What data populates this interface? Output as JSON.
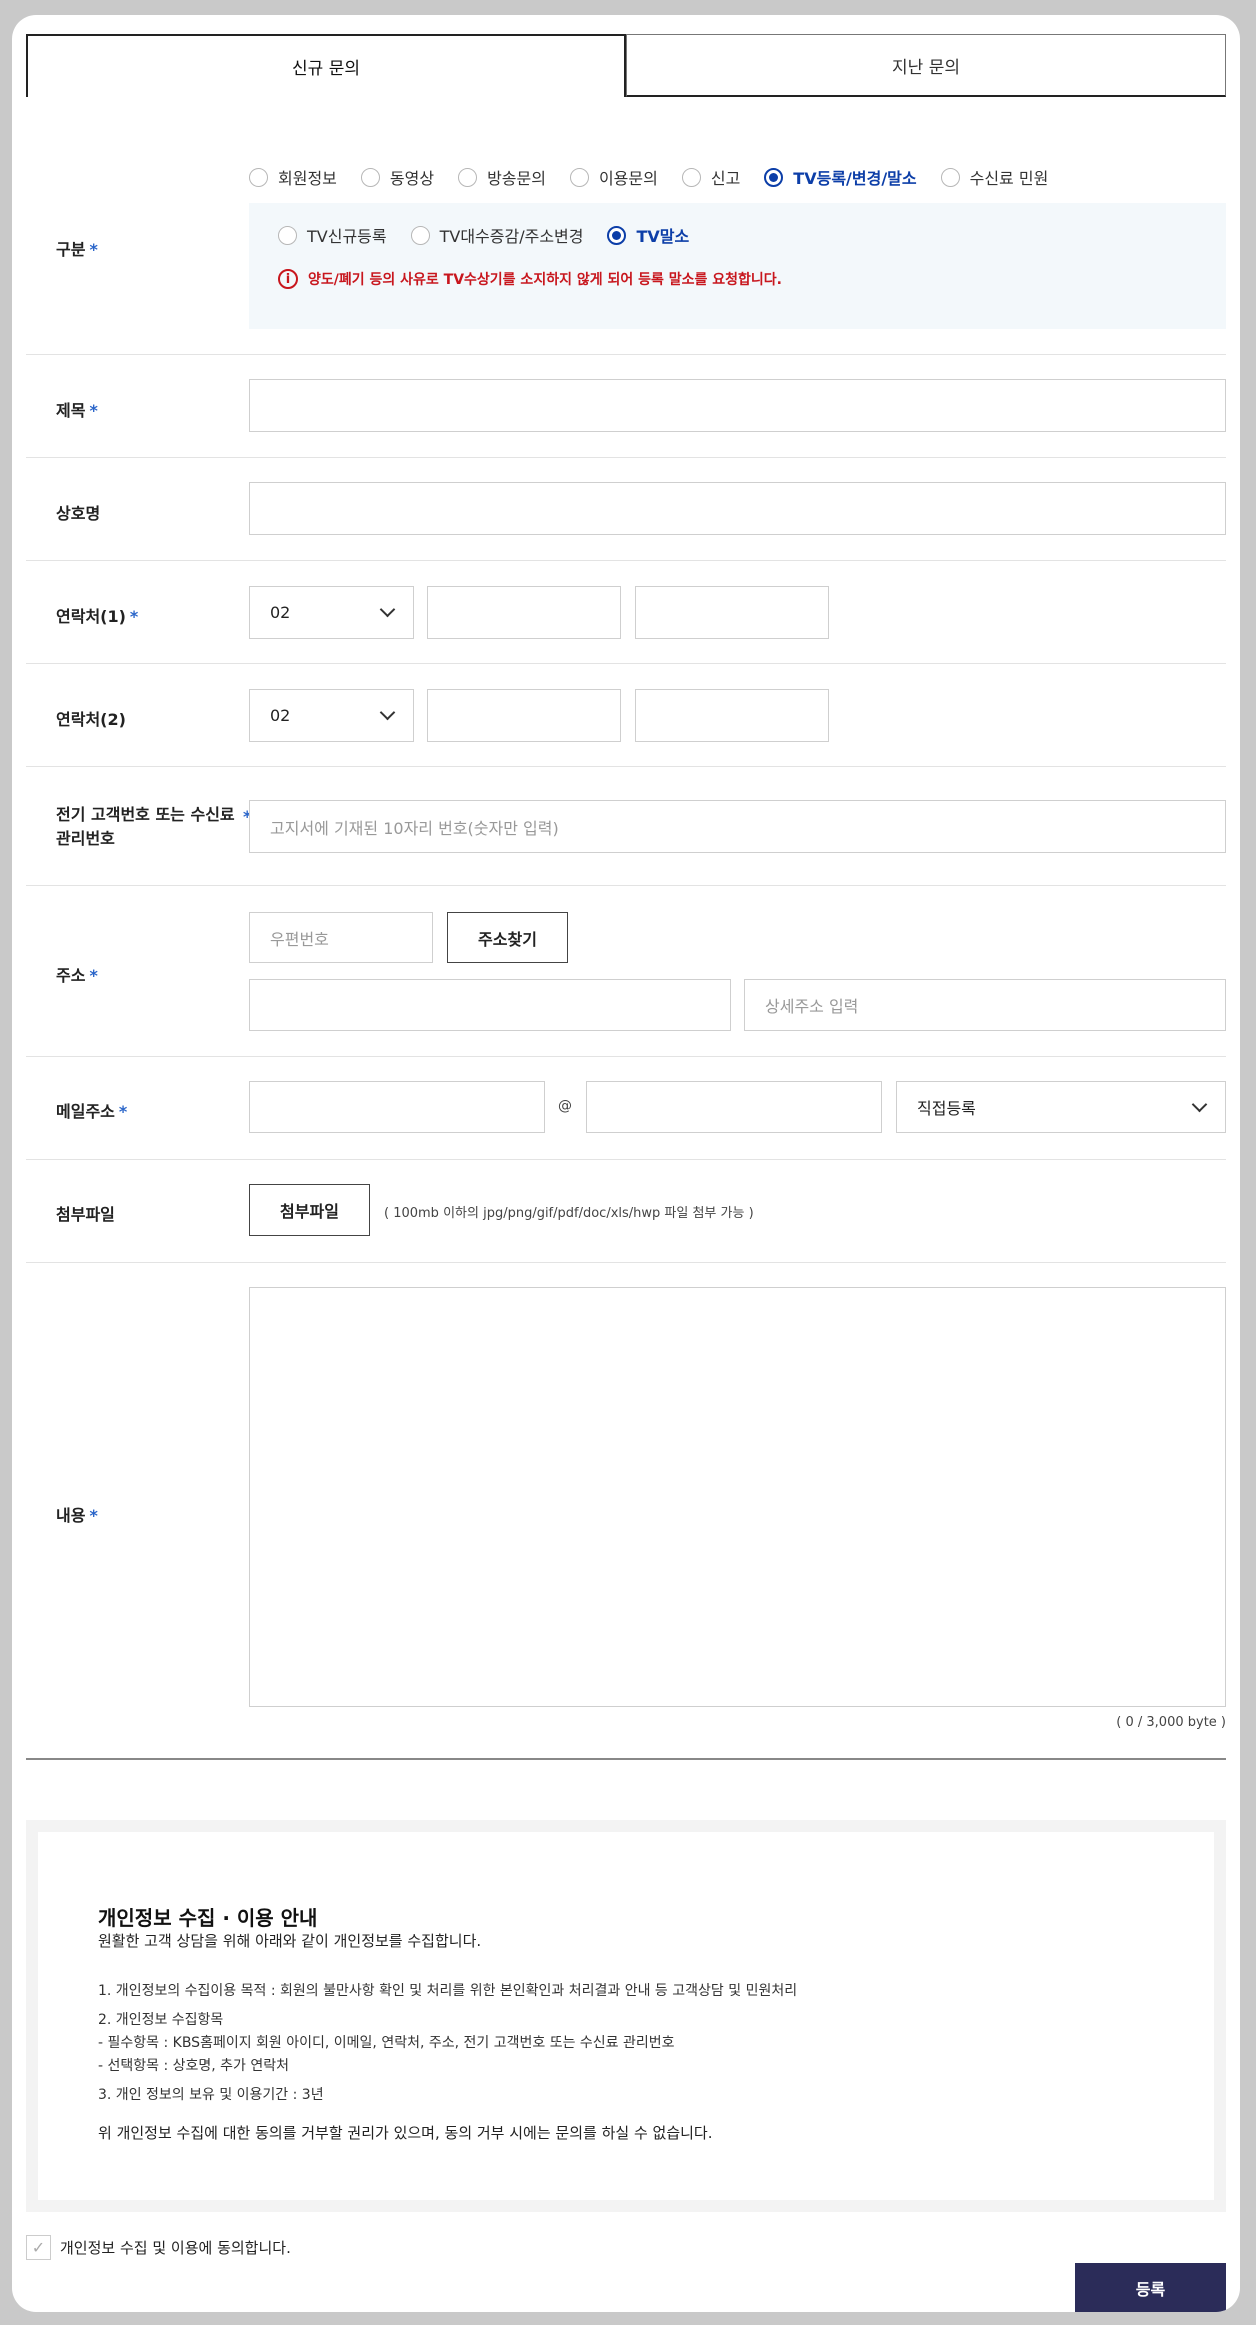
{
  "tabs": {
    "new": "신규 문의",
    "past": "지난 문의"
  },
  "form": {
    "category": {
      "label": "구분",
      "options": [
        "회원정보",
        "동영상",
        "방송문의",
        "이용문의",
        "신고",
        "TV등록/변경/말소",
        "수신료 민원"
      ],
      "selected": "TV등록/변경/말소",
      "sub_options": [
        "TV신규등록",
        "TV대수증감/주소변경",
        "TV말소"
      ],
      "sub_selected": "TV말소",
      "warning": "양도/폐기 등의 사유로 TV수상기를 소지하지 않게 되어 등록 말소를 요청합니다."
    },
    "title_label": "제목",
    "company_label": "상호명",
    "contact1": {
      "label": "연락처(1)",
      "area_code": "02"
    },
    "contact2": {
      "label": "연락처(2)",
      "area_code": "02"
    },
    "customer_no": {
      "label_line1": "전기 고객번호 또는 수신료",
      "label_line2": "관리번호",
      "placeholder": "고지서에 기재된 10자리 번호(숫자만 입력)"
    },
    "address": {
      "label": "주소",
      "zip_placeholder": "우편번호",
      "search_button": "주소찾기",
      "detail_placeholder": "상세주소 입력"
    },
    "email": {
      "label": "메일주소",
      "at": "@",
      "domain_select": "직접등록"
    },
    "attachment": {
      "label": "첨부파일",
      "button": "첨부파일",
      "note": "( 100mb 이하의 jpg/png/gif/pdf/doc/xls/hwp 파일 첨부 가능 )"
    },
    "content": {
      "label": "내용",
      "counter": "( 0 / 3,000 byte )"
    },
    "required_mark": "*"
  },
  "privacy": {
    "title": "개인정보 수집 · 이용 안내",
    "intro": "원활한 고객 상담을 위해 아래와 같이 개인정보를 수집합니다.",
    "item1": "1. 개인정보의 수집이용 목적 : 회원의 불만사항 확인 및 처리를 위한 본인확인과 처리결과 안내 등 고객상담 및 민원처리",
    "item2": "2. 개인정보 수집항목",
    "item2a": "- 필수항목 : KBS홈페이지 회원 아이디, 이메일, 연락처, 주소, 전기 고객번호 또는 수신료 관리번호",
    "item2b": "- 선택항목 : 상호명, 추가 연락처",
    "item3": "3. 개인 정보의 보유 및 이용기간 : 3년",
    "notice": "위 개인정보 수집에 대한 동의를 거부할 권리가 있으며, 동의 거부 시에는 문의를 하실 수 없습니다."
  },
  "agree_label": "개인정보 수집 및 이용에 동의합니다.",
  "submit_label": "등록",
  "colors": {
    "accent": "#0c3ea8",
    "required": "#2a65c9",
    "warning": "#c8161d",
    "submit_bg": "#2b2c59"
  }
}
